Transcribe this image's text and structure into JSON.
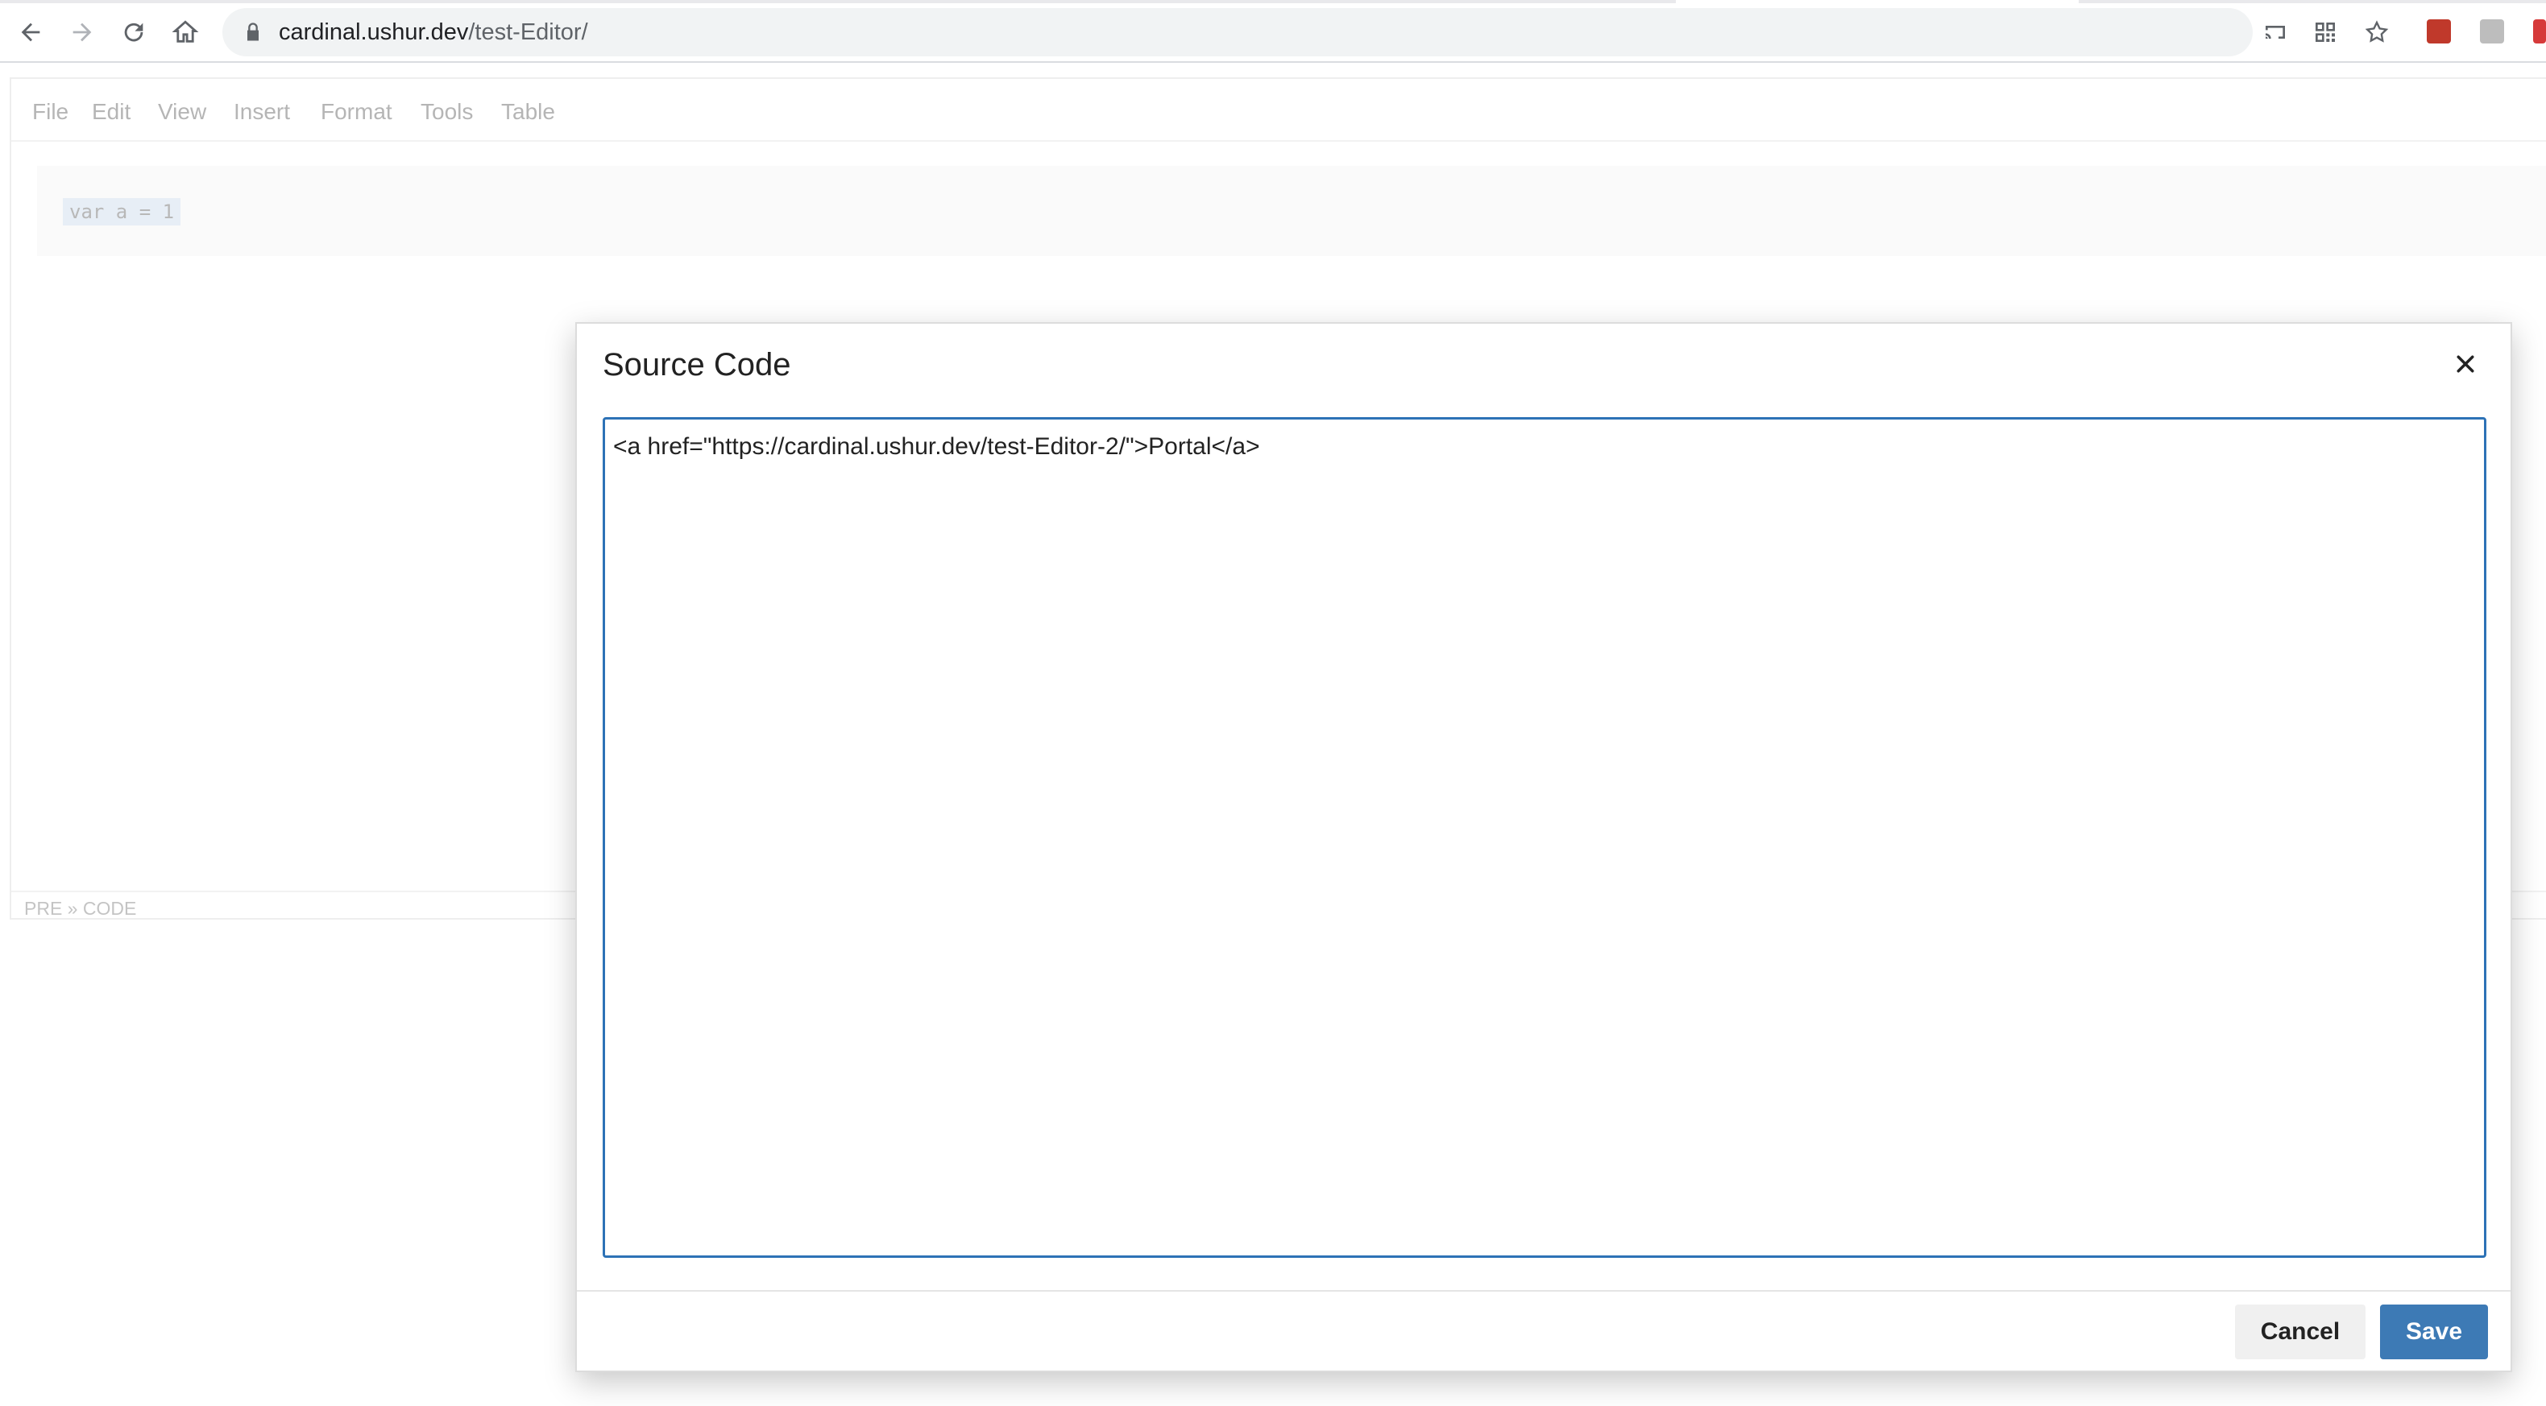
{
  "browser": {
    "url_host": "cardinal.ushur.dev",
    "url_path": "/test-Editor/",
    "icons": [
      "back-icon",
      "forward-icon",
      "reload-icon",
      "home-icon",
      "lock-icon",
      "cast-icon",
      "qr-code-icon",
      "star-icon"
    ]
  },
  "editor": {
    "menu": [
      "File",
      "Edit",
      "View",
      "Insert",
      "Format",
      "Tools",
      "Table"
    ],
    "code_snippet": "var a = 1",
    "status_path": "PRE » CODE"
  },
  "dialog": {
    "title": "Source Code",
    "source_value": "<a href=\"https://cardinal.ushur.dev/test-Editor-2/\">Portal</a>",
    "cancel_label": "Cancel",
    "save_label": "Save"
  },
  "colors": {
    "accent": "#2d72b6",
    "save_button": "#3d7ab5",
    "cancel_button": "#f0f0f0"
  }
}
